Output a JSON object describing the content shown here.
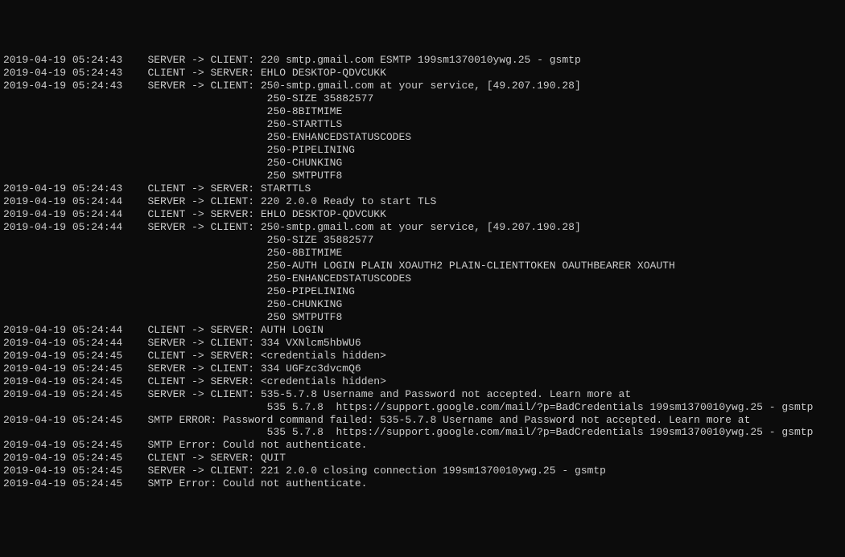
{
  "lines": [
    {
      "ts": "2019-04-19 05:24:43",
      "dir": "SERVER -> CLIENT:",
      "pad": "    ",
      "msg": "220 smtp.gmail.com ESMTP 199sm1370010ywg.25 - gsmtp"
    },
    {
      "ts": "2019-04-19 05:24:43",
      "dir": "CLIENT -> SERVER:",
      "pad": "    ",
      "msg": "EHLO DESKTOP-QDVCUKK"
    },
    {
      "ts": "2019-04-19 05:24:43",
      "dir": "SERVER -> CLIENT:",
      "pad": "    ",
      "msg": "250-smtp.gmail.com at your service, [49.207.190.28]"
    },
    {
      "ts": "",
      "dir": "",
      "pad": "                                          ",
      "msg": "250-SIZE 35882577"
    },
    {
      "ts": "",
      "dir": "",
      "pad": "                                          ",
      "msg": "250-8BITMIME"
    },
    {
      "ts": "",
      "dir": "",
      "pad": "                                          ",
      "msg": "250-STARTTLS"
    },
    {
      "ts": "",
      "dir": "",
      "pad": "                                          ",
      "msg": "250-ENHANCEDSTATUSCODES"
    },
    {
      "ts": "",
      "dir": "",
      "pad": "                                          ",
      "msg": "250-PIPELINING"
    },
    {
      "ts": "",
      "dir": "",
      "pad": "                                          ",
      "msg": "250-CHUNKING"
    },
    {
      "ts": "",
      "dir": "",
      "pad": "                                          ",
      "msg": "250 SMTPUTF8"
    },
    {
      "ts": "2019-04-19 05:24:43",
      "dir": "CLIENT -> SERVER:",
      "pad": "    ",
      "msg": "STARTTLS"
    },
    {
      "ts": "2019-04-19 05:24:44",
      "dir": "SERVER -> CLIENT:",
      "pad": "    ",
      "msg": "220 2.0.0 Ready to start TLS"
    },
    {
      "ts": "2019-04-19 05:24:44",
      "dir": "CLIENT -> SERVER:",
      "pad": "    ",
      "msg": "EHLO DESKTOP-QDVCUKK"
    },
    {
      "ts": "2019-04-19 05:24:44",
      "dir": "SERVER -> CLIENT:",
      "pad": "    ",
      "msg": "250-smtp.gmail.com at your service, [49.207.190.28]"
    },
    {
      "ts": "",
      "dir": "",
      "pad": "                                          ",
      "msg": "250-SIZE 35882577"
    },
    {
      "ts": "",
      "dir": "",
      "pad": "                                          ",
      "msg": "250-8BITMIME"
    },
    {
      "ts": "",
      "dir": "",
      "pad": "                                          ",
      "msg": "250-AUTH LOGIN PLAIN XOAUTH2 PLAIN-CLIENTTOKEN OAUTHBEARER XOAUTH"
    },
    {
      "ts": "",
      "dir": "",
      "pad": "                                          ",
      "msg": "250-ENHANCEDSTATUSCODES"
    },
    {
      "ts": "",
      "dir": "",
      "pad": "                                          ",
      "msg": "250-PIPELINING"
    },
    {
      "ts": "",
      "dir": "",
      "pad": "                                          ",
      "msg": "250-CHUNKING"
    },
    {
      "ts": "",
      "dir": "",
      "pad": "                                          ",
      "msg": "250 SMTPUTF8"
    },
    {
      "ts": "2019-04-19 05:24:44",
      "dir": "CLIENT -> SERVER:",
      "pad": "    ",
      "msg": "AUTH LOGIN"
    },
    {
      "ts": "2019-04-19 05:24:44",
      "dir": "SERVER -> CLIENT:",
      "pad": "    ",
      "msg": "334 VXNlcm5hbWU6"
    },
    {
      "ts": "2019-04-19 05:24:45",
      "dir": "CLIENT -> SERVER:",
      "pad": "    ",
      "msg": "<credentials hidden>"
    },
    {
      "ts": "2019-04-19 05:24:45",
      "dir": "SERVER -> CLIENT:",
      "pad": "    ",
      "msg": "334 UGFzc3dvcmQ6"
    },
    {
      "ts": "2019-04-19 05:24:45",
      "dir": "CLIENT -> SERVER:",
      "pad": "    ",
      "msg": "<credentials hidden>"
    },
    {
      "ts": "2019-04-19 05:24:45",
      "dir": "SERVER -> CLIENT:",
      "pad": "    ",
      "msg": "535-5.7.8 Username and Password not accepted. Learn more at"
    },
    {
      "ts": "",
      "dir": "",
      "pad": "                                          ",
      "msg": "535 5.7.8  https://support.google.com/mail/?p=BadCredentials 199sm1370010ywg.25 - gsmtp"
    },
    {
      "ts": "2019-04-19 05:24:45",
      "dir": "SMTP ERROR: Password command failed:",
      "pad": "    ",
      "msg": "535-5.7.8 Username and Password not accepted. Learn more at"
    },
    {
      "ts": "",
      "dir": "",
      "pad": "                                          ",
      "msg": "535 5.7.8  https://support.google.com/mail/?p=BadCredentials 199sm1370010ywg.25 - gsmtp"
    },
    {
      "ts": "2019-04-19 05:24:45",
      "dir": "SMTP Error: Could not authenticate.",
      "pad": "    ",
      "msg": ""
    },
    {
      "ts": "2019-04-19 05:24:45",
      "dir": "CLIENT -> SERVER:",
      "pad": "    ",
      "msg": "QUIT"
    },
    {
      "ts": "2019-04-19 05:24:45",
      "dir": "SERVER -> CLIENT:",
      "pad": "    ",
      "msg": "221 2.0.0 closing connection 199sm1370010ywg.25 - gsmtp"
    },
    {
      "ts": "2019-04-19 05:24:45",
      "dir": "SMTP Error: Could not authenticate.",
      "pad": "    ",
      "msg": ""
    }
  ]
}
